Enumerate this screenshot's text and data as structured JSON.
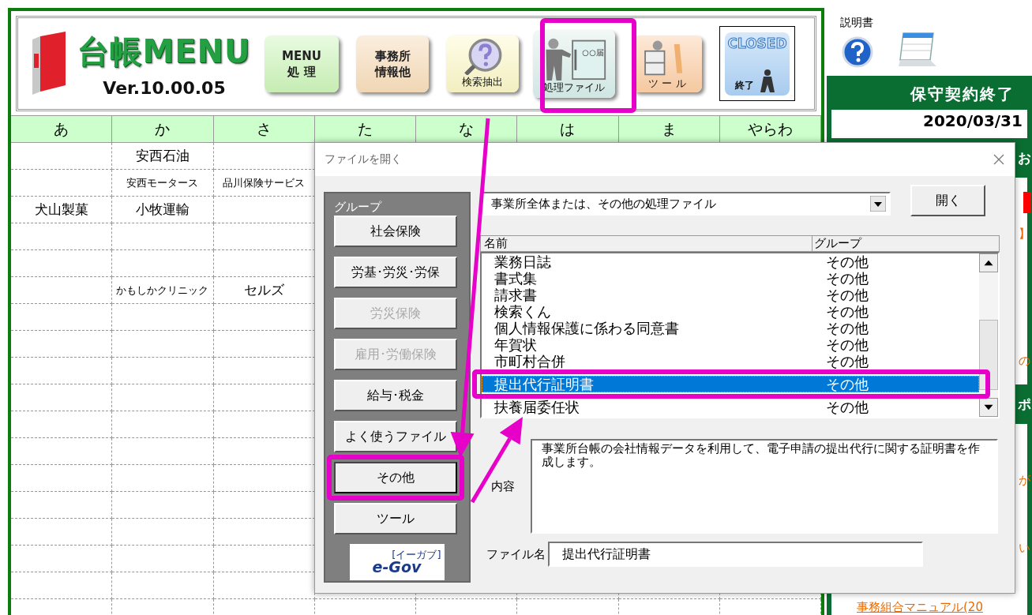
{
  "toolbar": {
    "title": "台帳MENU",
    "version": "Ver.10.00.05",
    "buttons": [
      {
        "kind": "menu",
        "lines": [
          "MENU",
          "処 理"
        ]
      },
      {
        "kind": "office",
        "lines": [
          "事務所",
          "情報他"
        ]
      },
      {
        "kind": "search",
        "caption": "検索抽出"
      },
      {
        "kind": "files",
        "caption": "処理ファイル",
        "tag": "○○届"
      },
      {
        "kind": "tools",
        "caption": "ツ ー ル"
      },
      {
        "kind": "closed",
        "badge": "CLOSED",
        "caption": "終了"
      }
    ]
  },
  "index_table": {
    "columns": [
      "あ",
      "か",
      "さ",
      "た",
      "な",
      "は",
      "ま",
      "やらわ"
    ],
    "rows": [
      [
        null,
        "安西石油",
        null
      ],
      [
        null,
        "安西モータース",
        "品川保険サービス"
      ],
      [
        "犬山製菓",
        "小牧運輸",
        null
      ],
      [
        null,
        null,
        null
      ],
      [
        null,
        null,
        null
      ],
      [
        null,
        "かもしかクリニック",
        "セルズ"
      ]
    ]
  },
  "help": {
    "label": "説明書"
  },
  "right_panel": {
    "title": "保守契約終了",
    "date": "2020/03/31",
    "fragments": [
      {
        "kind": "header",
        "text": "お"
      },
      {
        "kind": "alert"
      },
      {
        "kind": "link",
        "text": "】"
      },
      {
        "kind": "link",
        "text": "の"
      },
      {
        "kind": "header",
        "text": "ポ"
      },
      {
        "kind": "link",
        "text": "が"
      },
      {
        "kind": "link",
        "text": "い"
      },
      {
        "kind": "wide_link",
        "text": "事務組合マニュアル(20"
      }
    ]
  },
  "dialog": {
    "title": "ファイルを開く",
    "group_label": "グループ",
    "groups": [
      {
        "label": "社会保険",
        "disabled": false,
        "selected": false
      },
      {
        "label": "労基･労災･労保",
        "disabled": false,
        "selected": false
      },
      {
        "label": "労災保険",
        "disabled": true,
        "selected": false
      },
      {
        "label": "雇用･労働保険",
        "disabled": true,
        "selected": false
      },
      {
        "label": "給与･税金",
        "disabled": false,
        "selected": false
      },
      {
        "label": "よく使うファイル",
        "disabled": false,
        "selected": false
      },
      {
        "label": "その他",
        "disabled": false,
        "selected": true
      },
      {
        "label": "ツール",
        "disabled": false,
        "selected": false
      }
    ],
    "logo": {
      "text": "e-Gov",
      "reading": "[イーガブ]"
    },
    "category": "事業所全体または、その他の処理ファイル",
    "open_button": "開く",
    "list": {
      "columns": [
        "名前",
        "グループ"
      ],
      "rows": [
        {
          "name": "業務日誌",
          "group": "その他",
          "selected": false
        },
        {
          "name": "書式集",
          "group": "その他",
          "selected": false
        },
        {
          "name": "請求書",
          "group": "その他",
          "selected": false
        },
        {
          "name": "検索くん",
          "group": "その他",
          "selected": false
        },
        {
          "name": "個人情報保護に係わる同意書",
          "group": "その他",
          "selected": false
        },
        {
          "name": "年賀状",
          "group": "その他",
          "selected": false
        },
        {
          "name": "市町村合併",
          "group": "その他",
          "selected": false
        },
        {
          "name": "提出代行証明書",
          "group": "その他",
          "selected": true
        },
        {
          "name": "扶養届委任状",
          "group": "その他",
          "selected": false
        }
      ]
    },
    "description_label": "内容",
    "description": "事業所台帳の会社情報データを利用して、電子申請の提出代行に関する証明書を作成します。",
    "filename_label": "ファイル名",
    "filename": "提出代行証明書"
  }
}
